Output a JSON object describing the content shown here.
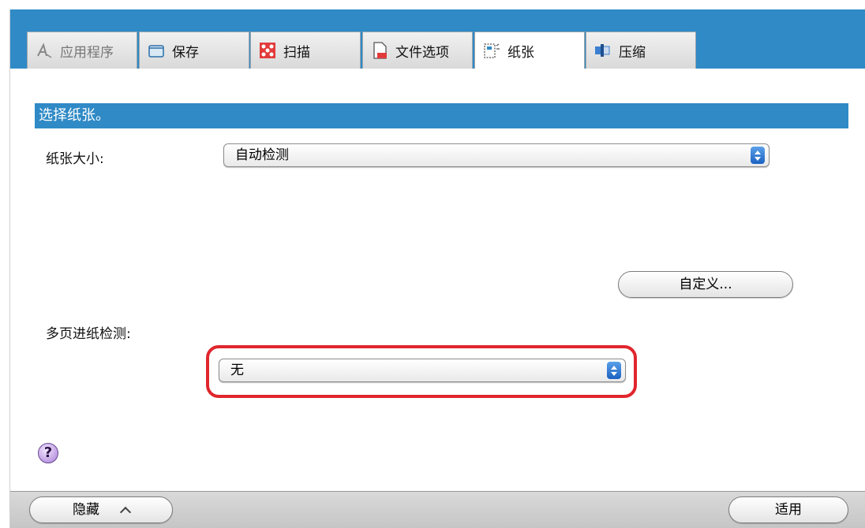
{
  "tabs": [
    {
      "label": "应用程序",
      "icon": "application-icon",
      "state": "disabled"
    },
    {
      "label": "保存",
      "icon": "folder-icon",
      "state": "normal"
    },
    {
      "label": "扫描",
      "icon": "scan-icon",
      "state": "normal"
    },
    {
      "label": "文件选项",
      "icon": "file-options-icon",
      "state": "normal"
    },
    {
      "label": "纸张",
      "icon": "paper-icon",
      "state": "active"
    },
    {
      "label": "压缩",
      "icon": "compression-icon",
      "state": "normal"
    }
  ],
  "section": {
    "title": "选择纸张。"
  },
  "paper_size": {
    "label": "纸张大小:",
    "selected": "自动检测"
  },
  "custom_button": {
    "label": "自定义..."
  },
  "multifeed": {
    "label": "多页进纸检测:",
    "selected": "无"
  },
  "help": {
    "glyph": "?"
  },
  "footer": {
    "hide_label": "隐藏",
    "apply_label": "适用"
  },
  "colors": {
    "accent": "#2f8ac6",
    "highlight": "#e0262d"
  }
}
